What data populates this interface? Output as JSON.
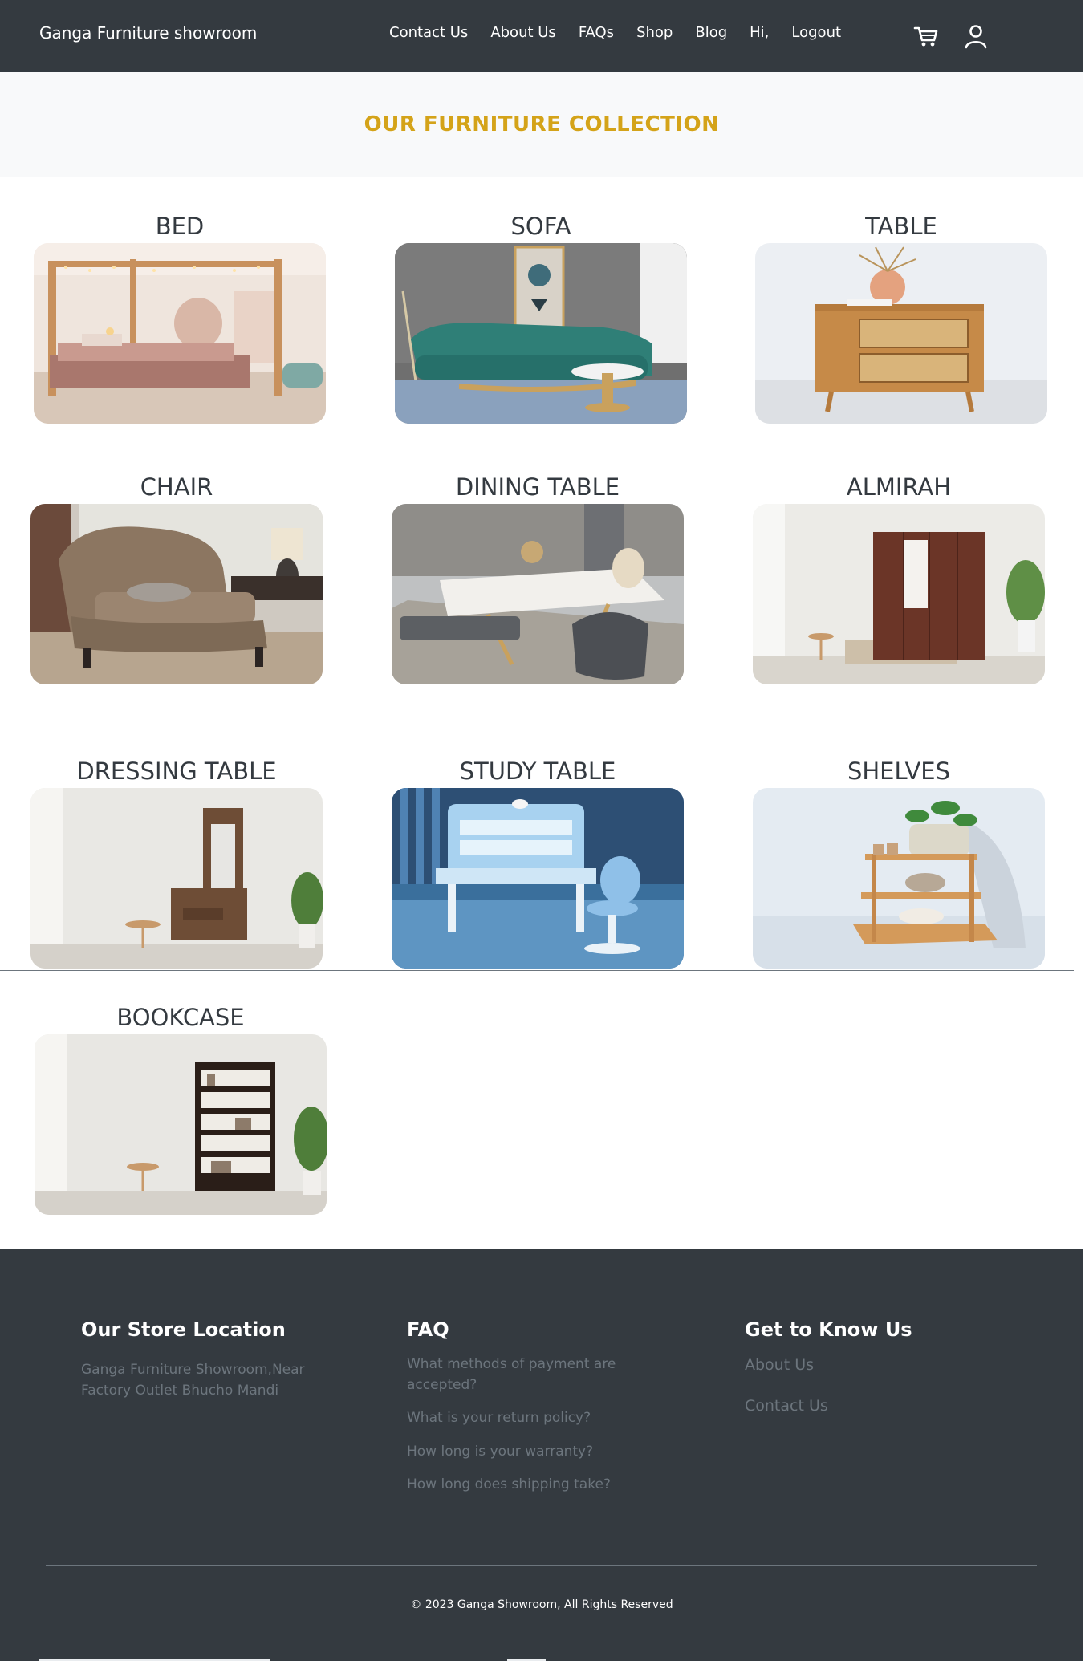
{
  "navbar": {
    "brand": "Ganga Furniture showroom",
    "links": [
      "Contact Us",
      "About Us",
      "FAQs",
      "Shop",
      "Blog",
      "Hi,",
      "Logout"
    ],
    "icons": [
      "cart-icon",
      "user-icon"
    ]
  },
  "hero": {
    "title": "OUR FURNITURE COLLECTION"
  },
  "categories": [
    {
      "title": "BED"
    },
    {
      "title": "SOFA"
    },
    {
      "title": "TABLE"
    },
    {
      "title": "CHAIR"
    },
    {
      "title": "DINING TABLE"
    },
    {
      "title": "ALMIRAH"
    },
    {
      "title": "DRESSING TABLE"
    },
    {
      "title": "STUDY TABLE"
    },
    {
      "title": "SHELVES"
    },
    {
      "title": "BOOKCASE"
    }
  ],
  "footer": {
    "store": {
      "heading": "Our Store Location",
      "address_line1": "Ganga Furniture Showroom,Near",
      "address_line2": "Factory Outlet Bhucho Mandi"
    },
    "faq": {
      "heading": "FAQ",
      "items": [
        "What methods of payment are",
        "accepted?",
        "What is your return policy?",
        "How long is your warranty?",
        "How long does shipping take?"
      ]
    },
    "know": {
      "heading": "Get to Know Us",
      "links": [
        "About Us",
        "Contact Us"
      ]
    },
    "copyright": "© 2023 Ganga Showroom, All Rights Reserved"
  },
  "colors": {
    "navbar_bg": "#343a40",
    "accent": "#d4a319",
    "hero_bg": "#f8f9fa",
    "footer_text_muted": "#6c757d"
  }
}
